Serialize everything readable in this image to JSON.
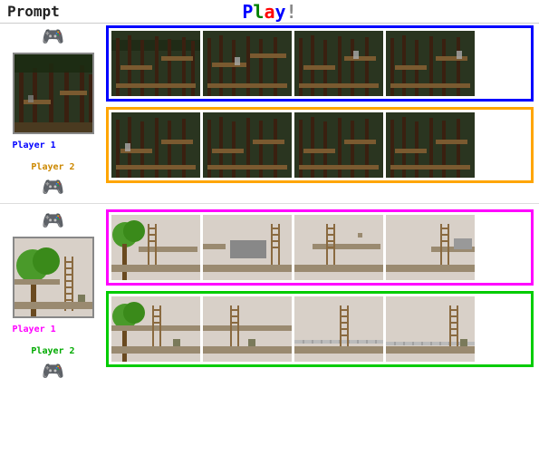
{
  "header": {
    "prompt_label": "Prompt",
    "play_label": "Play!"
  },
  "sections": [
    {
      "id": "forest-section",
      "preview": {
        "scene": "forest-dark"
      },
      "players": [
        {
          "id": "player1",
          "label": "Player 1",
          "color": "blue",
          "border_color": "#0000FF",
          "frames": 4
        },
        {
          "id": "player2",
          "label": "Player 2",
          "color": "yellow",
          "border_color": "#FFA500",
          "frames": 4
        }
      ]
    },
    {
      "id": "platform-section",
      "preview": {
        "scene": "platform-light"
      },
      "players": [
        {
          "id": "player1b",
          "label": "Player 1",
          "color": "magenta",
          "border_color": "#FF00FF",
          "frames": 4
        },
        {
          "id": "player2b",
          "label": "Player 2",
          "color": "green",
          "border_color": "#00CC00",
          "frames": 4
        }
      ]
    }
  ]
}
